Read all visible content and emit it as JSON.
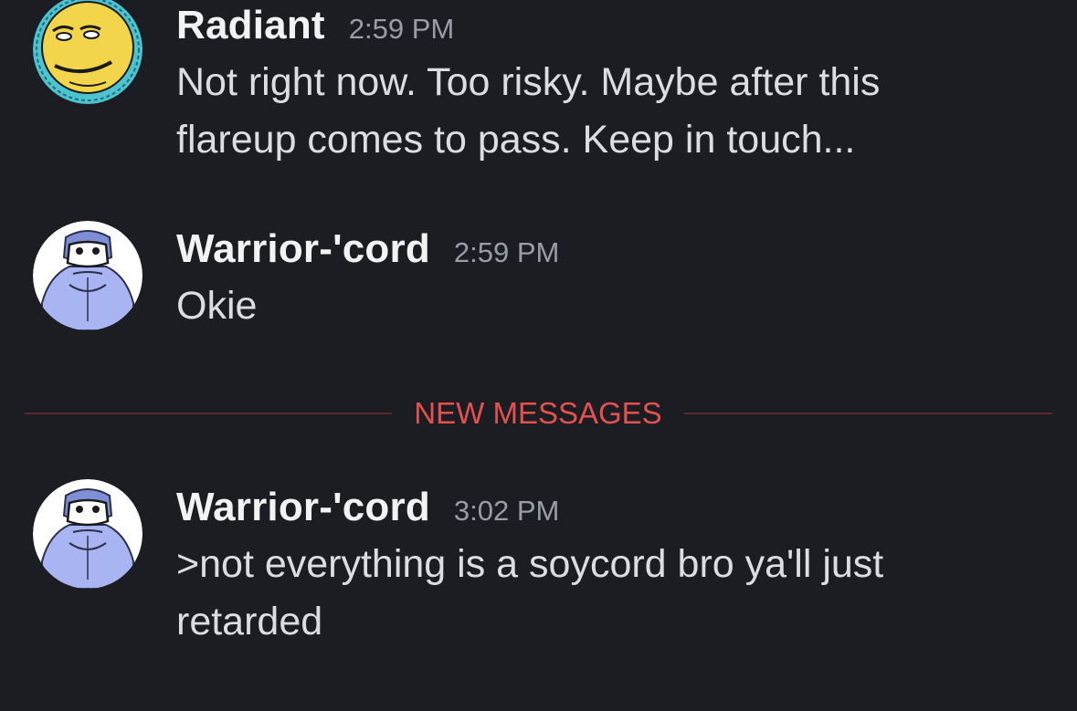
{
  "messages": [
    {
      "author": "Radiant",
      "timestamp": "2:59 PM",
      "text": "Not right now. Too risky. Maybe after this\nflareup comes to pass. Keep in touch..."
    },
    {
      "author": "Warrior-'cord",
      "timestamp": "2:59 PM",
      "text": "Okie"
    },
    {
      "author": "Warrior-'cord",
      "timestamp": "3:02 PM",
      "text": ">not everything is a soycord bro ya'll just\nretarded"
    }
  ],
  "divider": {
    "label": "NEW MESSAGES",
    "color": "#e2514f"
  },
  "colors": {
    "background": "#1c1d23",
    "author": "#f2f3f5",
    "timestamp": "#9a9ca6",
    "text": "#dcdde1"
  }
}
